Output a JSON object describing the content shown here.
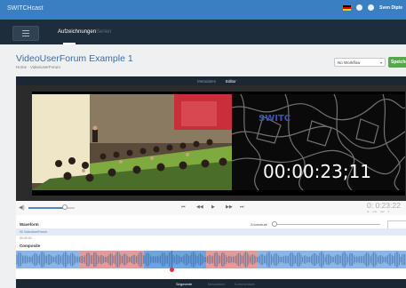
{
  "app": {
    "title": "SWITCHcast",
    "user": "Sven Dipte"
  },
  "nav": {
    "tabs": [
      {
        "label": "Aufzeichnungen",
        "active": true
      },
      {
        "label": "Serien",
        "active": false
      }
    ]
  },
  "header": {
    "title": "VideoUserForum Example 1",
    "breadcrumb": "Home · VideoUserForum",
    "workflow_select": "No Workflow",
    "start_button": "Speichern"
  },
  "editor_tabs": [
    {
      "label": "Metadaten",
      "active": false
    },
    {
      "label": "Editor",
      "active": true
    }
  ],
  "player": {
    "timecode": "00:00:23;11",
    "small_timecode": "0: 0:23:22",
    "units": "hr min sec fr"
  },
  "timeline": {
    "waveform_label": "Waveform",
    "composite_label": "Composite",
    "zoom_label": "Zoomstufe",
    "track_label": "00 VideoUserForum",
    "ruler_time": "00:00:00"
  },
  "bottom_tabs": [
    {
      "label": "Segmente",
      "active": true
    },
    {
      "label": "Metadaten",
      "active": false
    },
    {
      "label": "Kommentare",
      "active": false
    }
  ],
  "colors": {
    "topbar": "#3a7fc1",
    "nav": "#1e2d3b",
    "accent": "#3d6c9e",
    "start_button": "#57a64e",
    "segment_blue": "#6ea4df",
    "segment_red": "#e08a8a"
  }
}
